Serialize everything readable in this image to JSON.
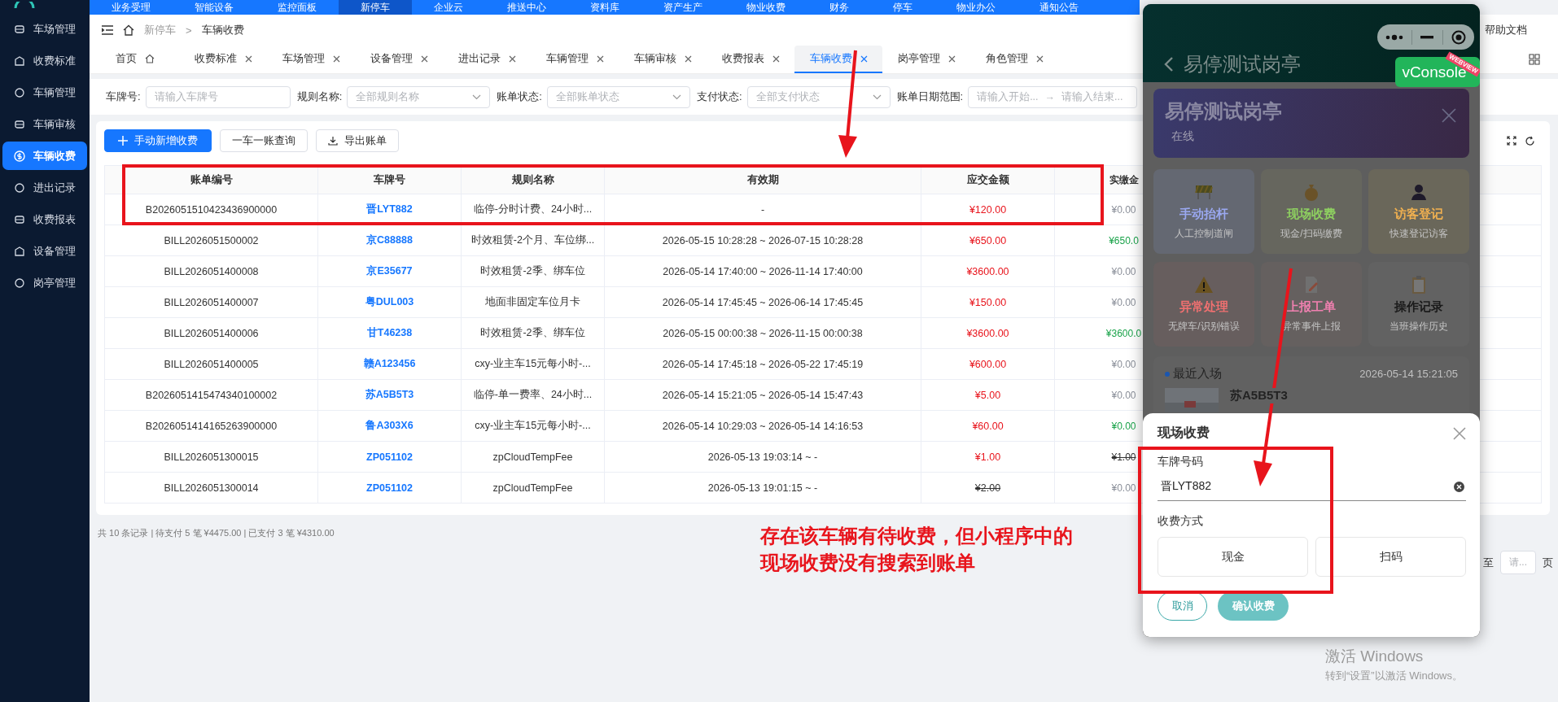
{
  "top_nav": {
    "items": [
      {
        "label": "业务受理",
        "selected": false
      },
      {
        "label": "智能设备",
        "selected": false
      },
      {
        "label": "监控面板",
        "selected": false
      },
      {
        "label": "新停车",
        "selected": true
      },
      {
        "label": "企业云",
        "selected": false
      },
      {
        "label": "推送中心",
        "selected": false
      },
      {
        "label": "资料库",
        "selected": false
      },
      {
        "label": "资产生产",
        "selected": false
      },
      {
        "label": "物业收费",
        "selected": false
      },
      {
        "label": "财务",
        "selected": false
      },
      {
        "label": "停车",
        "selected": false
      },
      {
        "label": "物业办公",
        "selected": false
      },
      {
        "label": "通知公告",
        "selected": false
      }
    ]
  },
  "sidebar": {
    "items": [
      {
        "label": "车场管理",
        "selected": false
      },
      {
        "label": "收费标准",
        "selected": false
      },
      {
        "label": "车辆管理",
        "selected": false
      },
      {
        "label": "车辆审核",
        "selected": false
      },
      {
        "label": "车辆收费",
        "selected": true
      },
      {
        "label": "进出记录",
        "selected": false
      },
      {
        "label": "收费报表",
        "selected": false
      },
      {
        "label": "设备管理",
        "selected": false
      },
      {
        "label": "岗亭管理",
        "selected": false
      }
    ]
  },
  "breadcrumb": {
    "items": [
      "新停车",
      "车辆收费"
    ],
    "separator": ">"
  },
  "help_link": "帮助文档",
  "tabs": [
    {
      "label": "首页",
      "selected": false,
      "closable": false
    },
    {
      "label": "收费标准",
      "selected": false,
      "closable": true
    },
    {
      "label": "车场管理",
      "selected": false,
      "closable": true
    },
    {
      "label": "设备管理",
      "selected": false,
      "closable": true
    },
    {
      "label": "进出记录",
      "selected": false,
      "closable": true
    },
    {
      "label": "车辆管理",
      "selected": false,
      "closable": true
    },
    {
      "label": "车辆审核",
      "selected": false,
      "closable": true
    },
    {
      "label": "收费报表",
      "selected": false,
      "closable": true
    },
    {
      "label": "车辆收费",
      "selected": true,
      "closable": true
    },
    {
      "label": "岗亭管理",
      "selected": false,
      "closable": true
    },
    {
      "label": "角色管理",
      "selected": false,
      "closable": true
    }
  ],
  "filters": [
    {
      "kind": "input",
      "label": "车牌号:",
      "placeholder": "请输入车牌号"
    },
    {
      "kind": "select",
      "label": "规则名称:",
      "placeholder": "全部规则名称"
    },
    {
      "kind": "select",
      "label": "账单状态:",
      "placeholder": "全部账单状态"
    },
    {
      "kind": "select",
      "label": "支付状态:",
      "placeholder": "全部支付状态"
    },
    {
      "kind": "date_range",
      "label": "账单日期范围:",
      "placeholder": "请输入开始...",
      "separator": "→",
      "end_placeholder": "请输入结束..."
    }
  ],
  "toolbar": {
    "buttons": [
      {
        "kind": "primary",
        "label": "手动新增收费"
      },
      {
        "kind": "default",
        "label": "一车一账查询"
      },
      {
        "kind": "export",
        "label": "导出账单"
      }
    ]
  },
  "table": {
    "columns": [
      "账单编号",
      "车牌号",
      "规则名称",
      "有效期",
      "应交金额",
      "实缴金"
    ],
    "rows": [
      {
        "bill_no": "B2026051510423436900000",
        "plate": "晋LYT882",
        "rule": "临停-分时计费、24小时...",
        "validity": "-",
        "due": {
          "text": "¥120.00",
          "kind": "due"
        },
        "paid": {
          "text": "¥0.00",
          "kind": "none"
        }
      },
      {
        "bill_no": "BILL2026051500002",
        "plate": "京C88888",
        "rule": "时效租赁-2个月、车位绑...",
        "validity": "2026-05-15 10:28:28 ~ 2026-07-15 10:28:28",
        "due": {
          "text": "¥650.00",
          "kind": "due"
        },
        "paid": {
          "text": "¥650.0",
          "kind": "paid"
        }
      },
      {
        "bill_no": "BILL2026051400008",
        "plate": "京E35677",
        "rule": "时效租赁-2季、绑车位",
        "validity": "2026-05-14 17:40:00 ~ 2026-11-14 17:40:00",
        "due": {
          "text": "¥3600.00",
          "kind": "due"
        },
        "paid": {
          "text": "¥0.00",
          "kind": "none"
        }
      },
      {
        "bill_no": "BILL2026051400007",
        "plate": "粤DUL003",
        "rule": "地面非固定车位月卡",
        "validity": "2026-05-14 17:45:45 ~ 2026-06-14 17:45:45",
        "due": {
          "text": "¥150.00",
          "kind": "due"
        },
        "paid": {
          "text": "¥0.00",
          "kind": "none"
        }
      },
      {
        "bill_no": "BILL2026051400006",
        "plate": "甘T46238",
        "rule": "时效租赁-2季、绑车位",
        "validity": "2026-05-15 00:00:38 ~ 2026-11-15 00:00:38",
        "due": {
          "text": "¥3600.00",
          "kind": "due"
        },
        "paid": {
          "text": "¥3600.0",
          "kind": "paid"
        }
      },
      {
        "bill_no": "BILL2026051400005",
        "plate": "赣A123456",
        "rule": "cxy-业主车15元每小时-...",
        "validity": "2026-05-14 17:45:18 ~ 2026-05-22 17:45:19",
        "due": {
          "text": "¥600.00",
          "kind": "due"
        },
        "paid": {
          "text": "¥0.00",
          "kind": "none"
        }
      },
      {
        "bill_no": "B2026051415474340100002",
        "plate": "苏A5B5T3",
        "rule": "临停-单一费率、24小时...",
        "validity": "2026-05-14 15:21:05 ~ 2026-05-14 15:47:43",
        "due": {
          "text": "¥5.00",
          "kind": "due"
        },
        "paid": {
          "text": "¥0.00",
          "kind": "none"
        }
      },
      {
        "bill_no": "B2026051414165263900000",
        "plate": "鲁A303X6",
        "rule": "cxy-业主车15元每小时-...",
        "validity": "2026-05-14 10:29:03 ~ 2026-05-14 14:16:53",
        "due": {
          "text": "¥60.00",
          "kind": "due"
        },
        "paid": {
          "text": "¥0.00",
          "kind": "paid"
        }
      },
      {
        "bill_no": "BILL2026051300015",
        "plate": "ZP051102",
        "rule": "zpCloudTempFee",
        "validity": "2026-05-13 19:03:14 ~ -",
        "due": {
          "text": "¥1.00",
          "kind": "due"
        },
        "paid": {
          "text": "¥1.00",
          "kind": "void"
        }
      },
      {
        "bill_no": "BILL2026051300014",
        "plate": "ZP051102",
        "rule": "zpCloudTempFee",
        "validity": "2026-05-13 19:01:15 ~ -",
        "due": {
          "text": "¥2.00",
          "kind": "void"
        },
        "paid": {
          "text": "¥0.00",
          "kind": "none"
        }
      }
    ]
  },
  "summary": "共 10 条记录 | 待支付 5 笔 ¥4475.00 | 已支付 3 笔 ¥4310.00",
  "pagination": {
    "jump_label": "至",
    "placeholder": "请...",
    "unit": "页"
  },
  "mini_program": {
    "title": "易停测试岗亭",
    "vconsole": {
      "label": "vConsole",
      "ribbon": "WEBVIEW"
    },
    "booth": {
      "name": "易停测试岗亭",
      "status": "在线"
    },
    "actions": [
      {
        "title": "手动抬杆",
        "subtitle": "人工控制道闸",
        "color": "#9aa8f0"
      },
      {
        "title": "现场收费",
        "subtitle": "现金/扫码缴费",
        "color": "#8ed060"
      },
      {
        "title": "访客登记",
        "subtitle": "快速登记访客",
        "color": "#f0b050"
      },
      {
        "title": "异常处理",
        "subtitle": "无牌车/识别错误",
        "color": "#f07070"
      },
      {
        "title": "上报工单",
        "subtitle": "异常事件上报",
        "color": "#f080b0"
      },
      {
        "title": "操作记录",
        "subtitle": "当班操作历史",
        "color": "#1a1a1a"
      }
    ],
    "recent": {
      "label": "最近入场",
      "time": "2026-05-14 15:21:05",
      "plate": "苏A5B5T3"
    },
    "sheet": {
      "title": "现场收费",
      "plate_label": "车牌号码",
      "plate_value": "晋LYT882",
      "method_label": "收费方式",
      "methods": [
        {
          "label": "现金",
          "selected": false
        },
        {
          "label": "扫码",
          "selected": false
        }
      ],
      "cancel": "取消",
      "confirm": "确认收费"
    }
  },
  "annotation": {
    "lines": [
      "存在该车辆有待收费，但小程序中的",
      "现场收费没有搜索到账单"
    ]
  },
  "os_watermark": {
    "title": "激活 Windows",
    "text": "转到“设置”以激活 Windows。"
  }
}
